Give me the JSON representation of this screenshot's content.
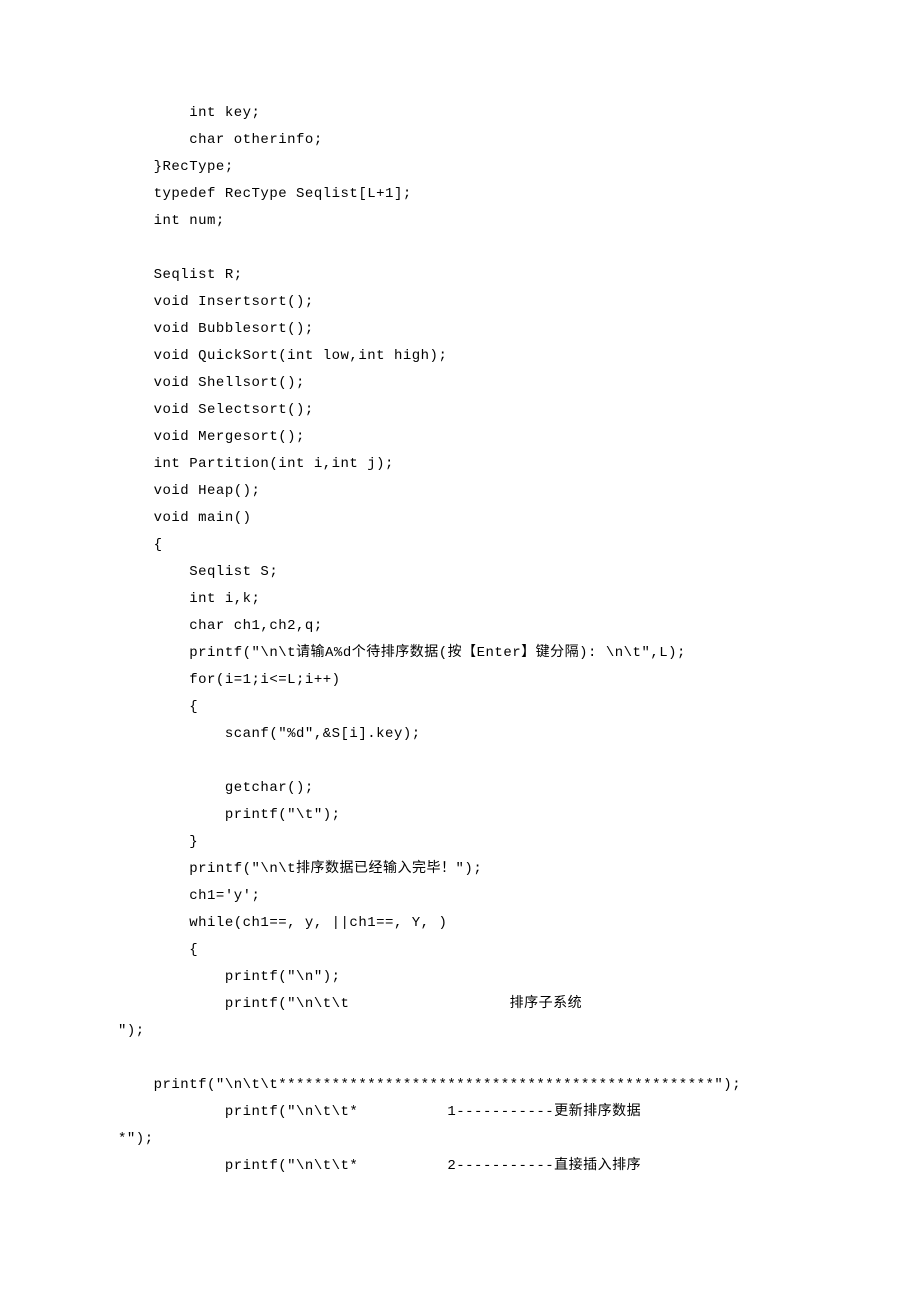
{
  "code_lines": [
    "        int key;",
    "        char otherinfo;",
    "    }RecType;",
    "    typedef RecType Seqlist[L+1];",
    "    int num;",
    "",
    "    Seqlist R;",
    "    void Insertsort();",
    "    void Bubblesort();",
    "    void QuickSort(int low,int high);",
    "    void Shellsort();",
    "    void Selectsort();",
    "    void Mergesort();",
    "    int Partition(int i,int j);",
    "    void Heap();",
    "    void main()",
    "    {",
    "        Seqlist S;",
    "        int i,k;",
    "        char ch1,ch2,q;",
    "        printf(\"\\n\\t请输A%d个待排序数据(按【Enter】键分隔): \\n\\t\",L);",
    "        for(i=1;i<=L;i++)",
    "        {",
    "            scanf(\"%d\",&S[i].key);",
    "",
    "            getchar();",
    "            printf(\"\\t\");",
    "        }",
    "        printf(\"\\n\\t排序数据已经输入完毕！\");",
    "        ch1='y';",
    "        while(ch1==, y, ||ch1==, Y, )",
    "        {",
    "            printf(\"\\n\");",
    "            printf(\"\\n\\t\\t                  排序子系统                 ",
    "\");",
    "",
    "    printf(\"\\n\\t\\t*************************************************\");",
    "            printf(\"\\n\\t\\t*          1-----------更新排序数据             ",
    "*\");",
    "            printf(\"\\n\\t\\t*          2-----------直接插入排序             "
  ]
}
